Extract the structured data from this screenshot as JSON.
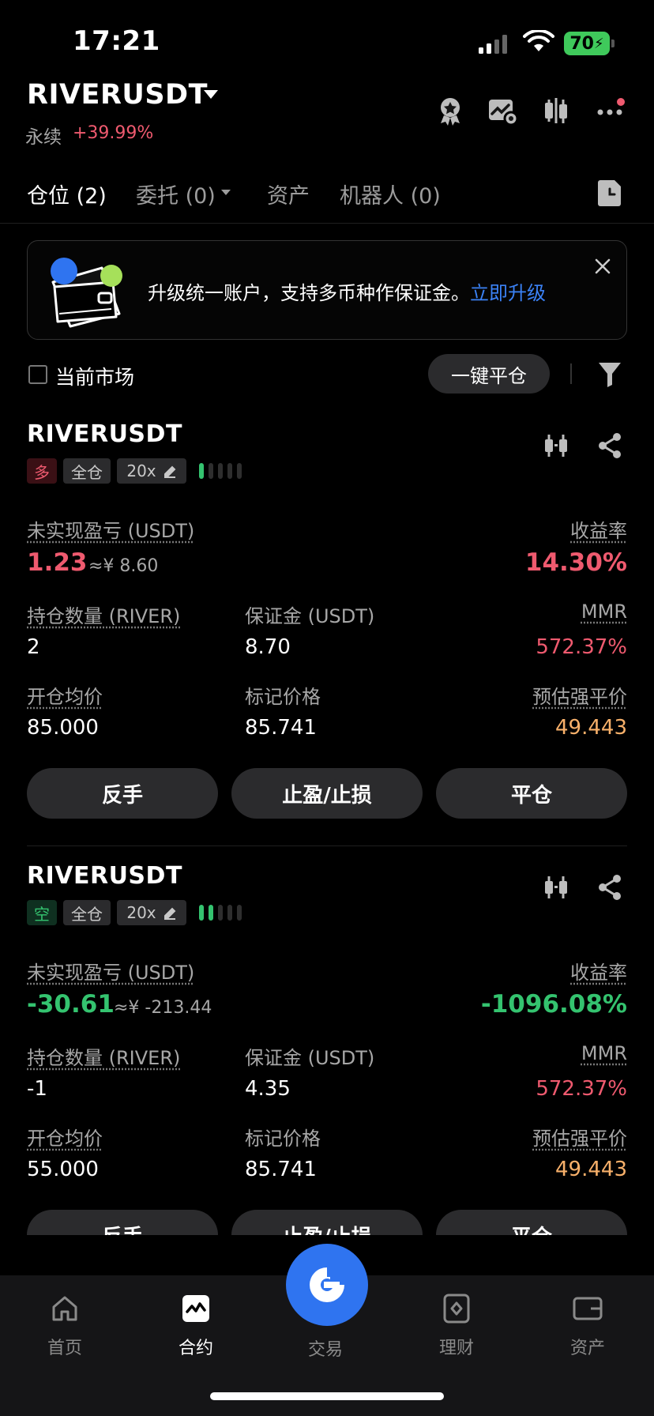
{
  "status_bar": {
    "time": "17:21",
    "battery": "70"
  },
  "header": {
    "symbol": "RIVERUSDT",
    "contract_type": "永续",
    "change": "+39.99%"
  },
  "tabs": [
    {
      "label": "仓位 (2)"
    },
    {
      "label": "委托 (0)"
    },
    {
      "label": "资产"
    },
    {
      "label": "机器人 (0)"
    }
  ],
  "banner": {
    "text": "升级统一账户，支持多币种作保证金。",
    "link": "立即升级"
  },
  "filter": {
    "current_market_label": "当前市场",
    "close_all_label": "一键平仓"
  },
  "positions": [
    {
      "symbol": "RIVERUSDT",
      "side": "多",
      "margin_mode": "全仓",
      "leverage": "20x",
      "adl_level": 1,
      "pnl_label": "未实现盈亏 (USDT)",
      "pnl": "1.23",
      "pnl_cny": "≈¥ 8.60",
      "roe_label": "收益率",
      "roe": "14.30%",
      "size_label": "持仓数量 (RIVER)",
      "size": "2",
      "margin_label": "保证金 (USDT)",
      "margin": "8.70",
      "mmr_label": "MMR",
      "mmr": "572.37%",
      "entry_label": "开仓均价",
      "entry": "85.000",
      "mark_label": "标记价格",
      "mark": "85.741",
      "liq_label": "预估强平价",
      "liq": "49.443",
      "btn_reverse": "反手",
      "btn_tpsl": "止盈/止损",
      "btn_close": "平仓"
    },
    {
      "symbol": "RIVERUSDT",
      "side": "空",
      "margin_mode": "全仓",
      "leverage": "20x",
      "adl_level": 2,
      "pnl_label": "未实现盈亏 (USDT)",
      "pnl": "-30.61",
      "pnl_cny": "≈¥ -213.44",
      "roe_label": "收益率",
      "roe": "-1096.08%",
      "size_label": "持仓数量 (RIVER)",
      "size": "-1",
      "margin_label": "保证金 (USDT)",
      "margin": "4.35",
      "mmr_label": "MMR",
      "mmr": "572.37%",
      "entry_label": "开仓均价",
      "entry": "55.000",
      "mark_label": "标记价格",
      "mark": "85.741",
      "liq_label": "预估强平价",
      "liq": "49.443",
      "btn_reverse": "反手",
      "btn_tpsl": "止盈/止损",
      "btn_close": "平仓"
    }
  ],
  "bottom_nav": [
    {
      "label": "首页",
      "icon": "home-icon"
    },
    {
      "label": "合约",
      "icon": "futures-icon"
    },
    {
      "label": "交易",
      "icon": "trade-icon"
    },
    {
      "label": "理财",
      "icon": "earn-icon"
    },
    {
      "label": "资产",
      "icon": "wallet-icon"
    }
  ],
  "colors": {
    "up": "#34c36f",
    "down": "#ef5a6f",
    "accent": "#2f74f0",
    "link": "#3b82f6"
  }
}
